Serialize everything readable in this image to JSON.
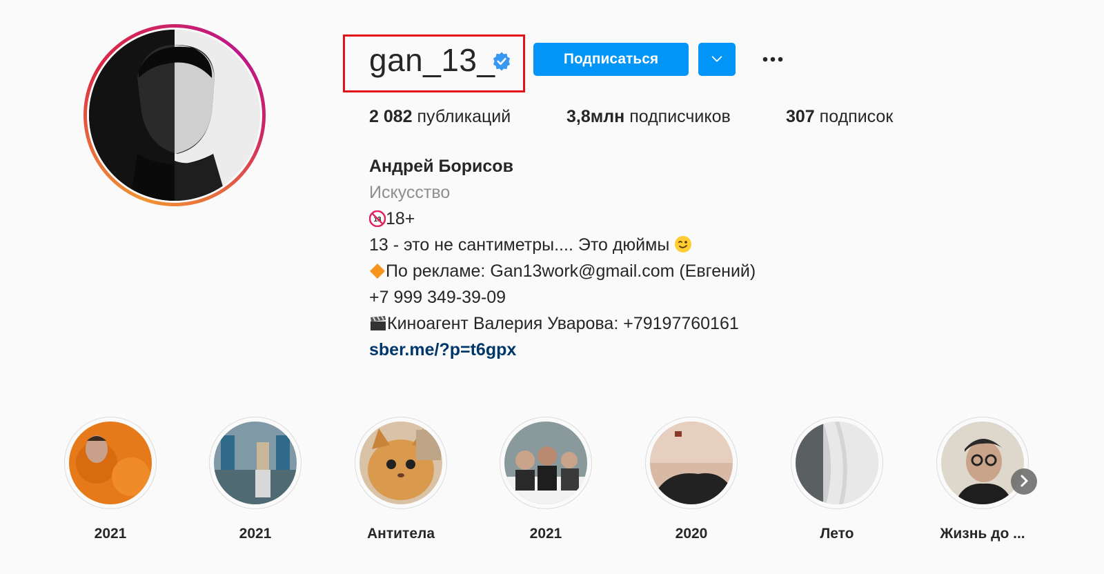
{
  "profile": {
    "username": "gan_13_",
    "verified": true,
    "follow_label": "Подписаться",
    "posts_count": "2 082",
    "posts_label": "публикаций",
    "followers_count": "3,8млн",
    "followers_label": "подписчиков",
    "following_count": "307",
    "following_label": "подписок",
    "full_name": "Андрей Борисов",
    "category": "Искусство",
    "bio_lines": [
      "18+",
      "13 - это не сантиметры.... Это дюймы",
      "По рекламе: Gan13work@gmail.com (Евгений)",
      "+7 999 349-39-09",
      "Киноагент Валерия Уварова: +79197760161"
    ],
    "link": "sber.me/?p=t6gpx"
  },
  "highlights": [
    {
      "label": "2021"
    },
    {
      "label": "2021"
    },
    {
      "label": "Антитела"
    },
    {
      "label": "2021"
    },
    {
      "label": "2020"
    },
    {
      "label": "Лето"
    },
    {
      "label": "Жизнь до ..."
    }
  ],
  "colors": {
    "accent": "#0095f6",
    "highlight_box": "#e3101a",
    "link": "#00376b",
    "muted": "#8e8e8e"
  },
  "icons": [
    "verified-badge-icon",
    "chevron-down-icon",
    "more-options-icon",
    "chevron-right-icon"
  ]
}
